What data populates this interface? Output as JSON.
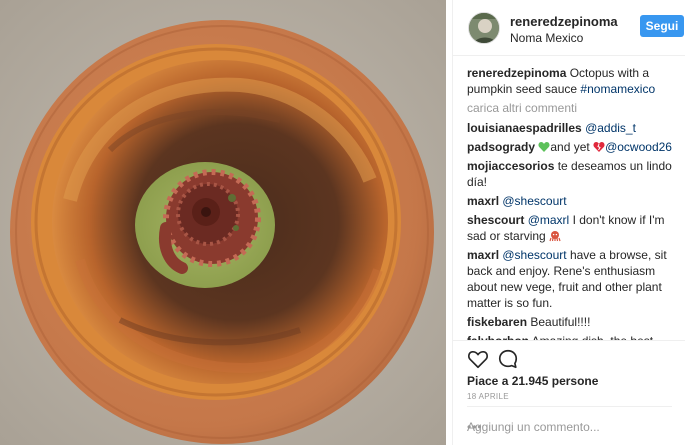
{
  "post": {
    "username": "reneredzepinoma",
    "location": "Noma Mexico",
    "follow_label": "Segui"
  },
  "caption": {
    "user": "reneredzepinoma",
    "text": "Octopus with a pumpkin seed sauce",
    "hashtag": "#nomamexico"
  },
  "load_more": "carica altri commenti",
  "comments": [
    {
      "user": "louisianaespadrilles",
      "mention": "@addis_t"
    },
    {
      "user": "padsogrady",
      "text_before": "",
      "text_mid": "and yet",
      "mention": "@ocwood26",
      "emojis": [
        "green-heart-icon",
        "broken-heart-icon"
      ]
    },
    {
      "user": "mojiaccesorios",
      "text": "te deseamos un lindo día!"
    },
    {
      "user": "maxrl",
      "mention": "@shescourt"
    },
    {
      "user": "shescourt",
      "mention": "@maxrl",
      "text": "I don't know if I'm sad or starving",
      "emoji": "octopus-icon"
    },
    {
      "user": "maxrl",
      "mention": "@shescourt",
      "text": "have a browse, sit back and enjoy. Rene's enthusiasm about new vege, fruit and other plant matter is so fun."
    },
    {
      "user": "fiskebaren",
      "text": "Beautiful!!!!"
    },
    {
      "user": "falyborbon",
      "text": "Amazing dish, the best octopus we have had in our life!!!! And"
    }
  ],
  "actions": {
    "likes": "Piace a 21.945 persone",
    "date": "18 APRILE",
    "add_comment_placeholder": "Aggiungi un commento...",
    "more_dots": "•••"
  },
  "colors": {
    "follow_button": "#3897f0",
    "mention_link": "#003569",
    "plate_outer": "#c87a4f",
    "plate_inner": "#d27c3c",
    "sauce": "#98a95a",
    "octopus": "#8a3a2e"
  }
}
